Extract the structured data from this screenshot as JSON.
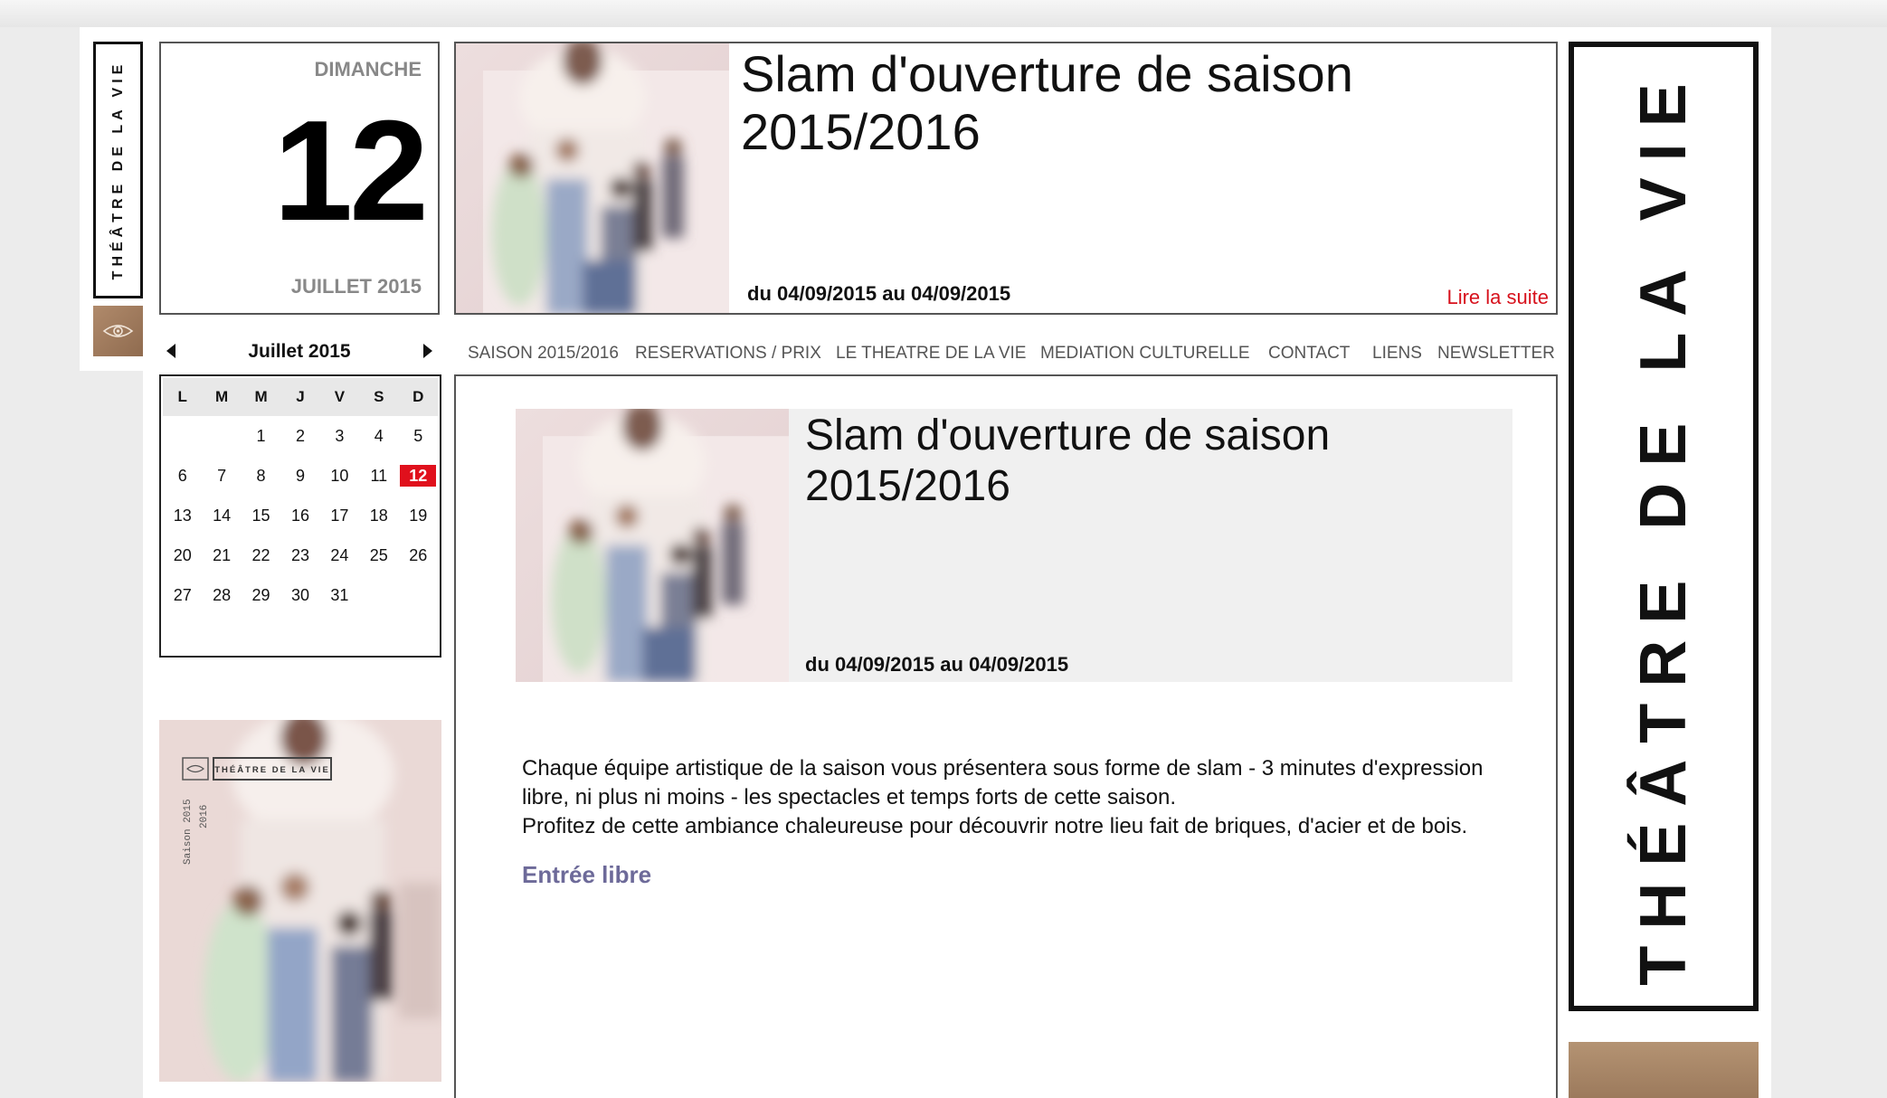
{
  "brand": {
    "name": "THÉÂTRE DE LA VIE"
  },
  "date": {
    "day_name": "DIMANCHE",
    "day_number": "12",
    "month_year": "JUILLET 2015"
  },
  "feature": {
    "title": "Slam d'ouverture de saison 2015/2016",
    "dates": "du 04/09/2015 au 04/09/2015",
    "more_link": "Lire la suite"
  },
  "calendar": {
    "title": "Juillet 2015",
    "weekdays": [
      "L",
      "M",
      "M",
      "J",
      "V",
      "S",
      "D"
    ],
    "weeks": [
      [
        "",
        "",
        "1",
        "2",
        "3",
        "4",
        "5"
      ],
      [
        "6",
        "7",
        "8",
        "9",
        "10",
        "11",
        "12"
      ],
      [
        "13",
        "14",
        "15",
        "16",
        "17",
        "18",
        "19"
      ],
      [
        "20",
        "21",
        "22",
        "23",
        "24",
        "25",
        "26"
      ],
      [
        "27",
        "28",
        "29",
        "30",
        "31",
        "",
        ""
      ]
    ],
    "selected_day": "12"
  },
  "nav": {
    "items": [
      "SAISON 2015/2016",
      "RESERVATIONS / PRIX",
      "LE THEATRE DE LA VIE",
      "MEDIATION CULTURELLE",
      "CONTACT",
      "LIENS",
      "NEWSLETTER"
    ]
  },
  "content": {
    "title": "Slam d'ouverture de saison 2015/2016",
    "dates": "du 04/09/2015 au 04/09/2015",
    "description_line1": "Chaque équipe artistique de la saison vous présentera sous forme de slam - 3 minutes d'expression libre, ni plus ni moins - les spectacles et temps forts de cette saison.",
    "description_line2": "Profitez de cette ambiance chaleureuse pour découvrir notre lieu fait de briques, d'acier et de bois.",
    "entry": "Entrée libre"
  },
  "brochure": {
    "brand": "THÉÂTRE DE LA VIE",
    "season": "Saison 2015",
    "year2": "2016"
  },
  "colors": {
    "accent_red": "#e0101c",
    "link_red": "#d7111c",
    "entry_purple": "#6d6a99",
    "brown": "#a88466"
  },
  "icons": [
    "eye-icon",
    "prev-month-arrow-icon",
    "next-month-arrow-icon"
  ]
}
